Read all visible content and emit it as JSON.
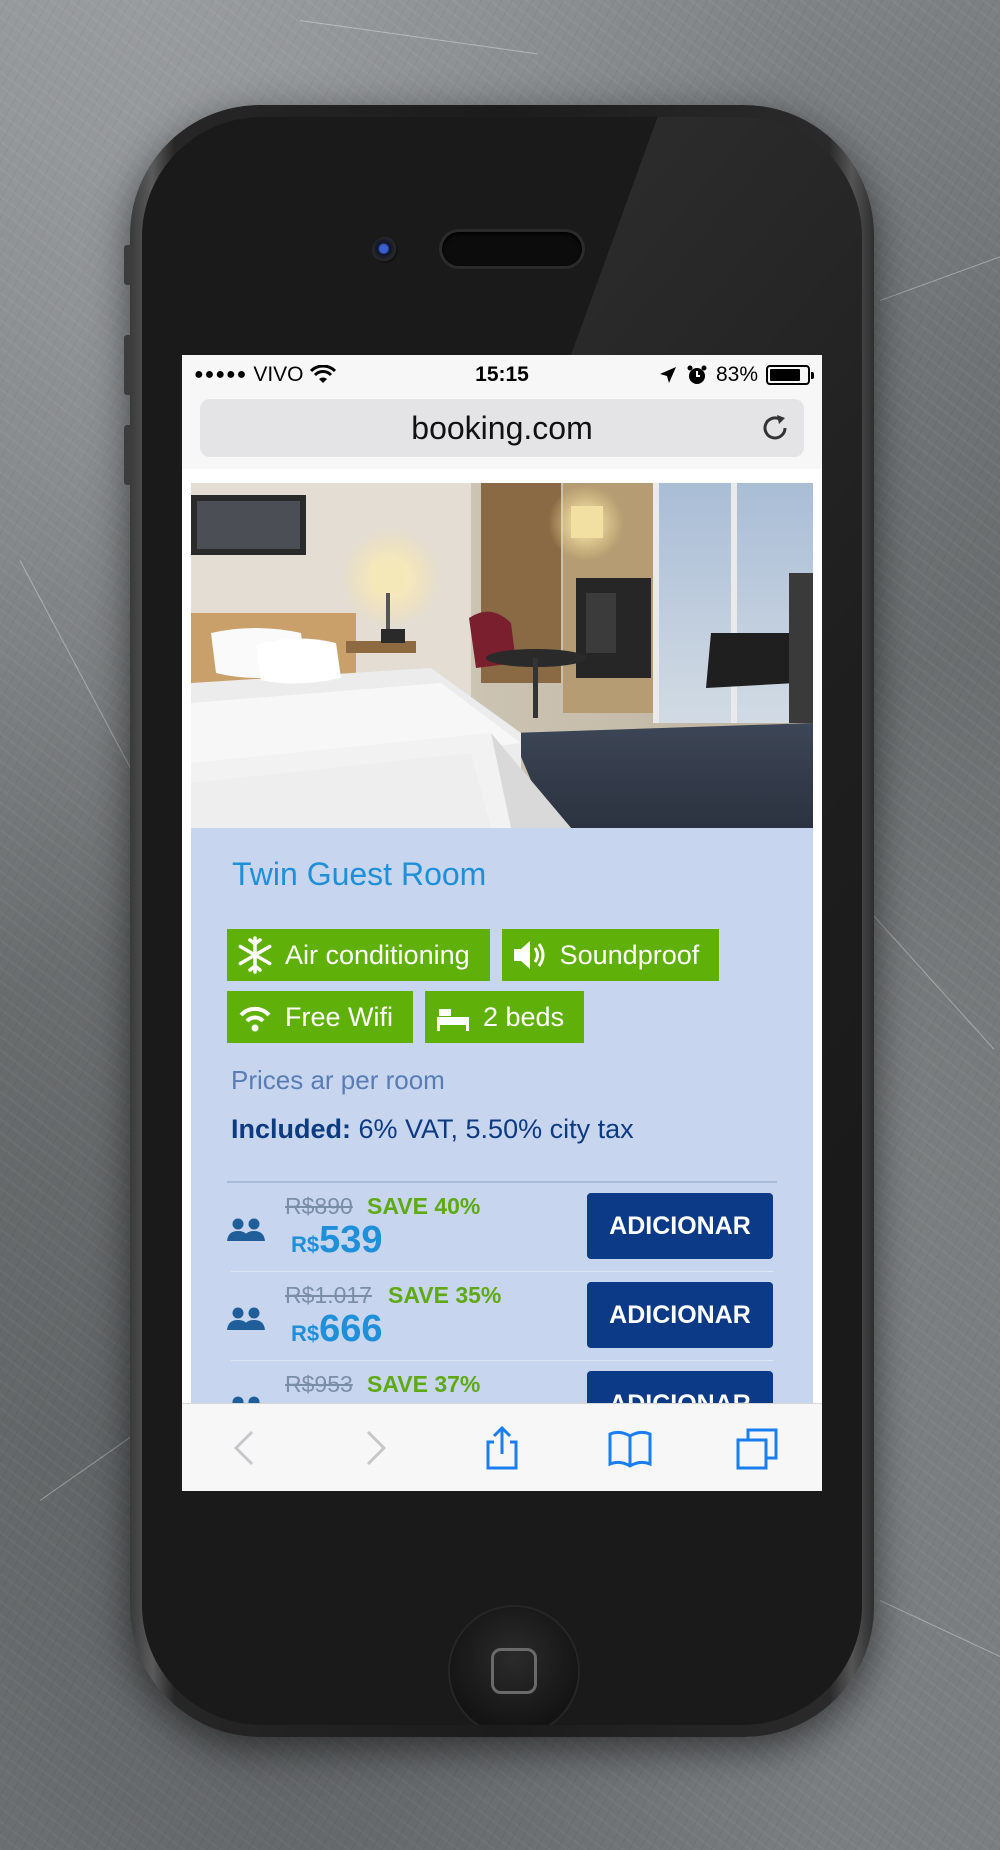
{
  "status_bar": {
    "carrier": "VIVO",
    "signal_dots": "●●●●●",
    "time": "15:15",
    "battery": "83%",
    "battery_level": 0.83
  },
  "browser": {
    "url": "booking.com"
  },
  "room": {
    "title": "Twin Guest Room",
    "features": [
      {
        "label": "Air conditioning",
        "icon": "snowflake-icon"
      },
      {
        "label": "Soundproof",
        "icon": "speaker-icon"
      },
      {
        "label": "Free Wifi",
        "icon": "wifi-icon"
      },
      {
        "label": "2 beds",
        "icon": "bed-icon"
      }
    ],
    "prices_note": "Prices ar per room",
    "included_label": "Included:",
    "included_text": " 6% VAT, 5.50% city tax"
  },
  "rates": [
    {
      "old_price": "R$890",
      "save": "SAVE 40%",
      "currency": "R$",
      "price": "539",
      "button": "ADICIONAR"
    },
    {
      "old_price": "R$1.017",
      "save": "SAVE 35%",
      "currency": "R$",
      "price": "666",
      "button": "ADICIONAR"
    },
    {
      "old_price": "R$953",
      "save": "SAVE 37%",
      "currency": "R$",
      "price": "",
      "button": "ADICIONAR"
    }
  ],
  "colors": {
    "accent_blue": "#1e8fd8",
    "feature_green": "#5fb10a",
    "button_navy": "#0c3a87",
    "card_bg": "#c7d6ee"
  }
}
